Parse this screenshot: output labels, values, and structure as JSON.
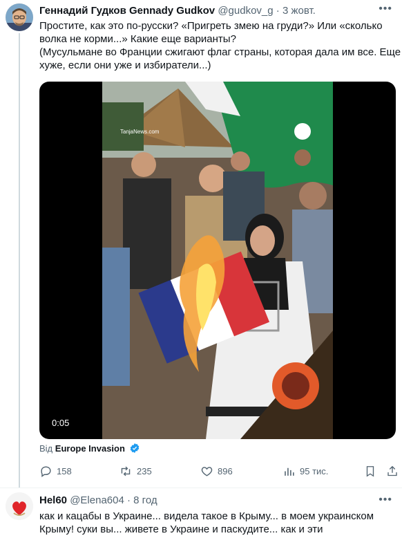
{
  "tweet1": {
    "author_name": "Геннадий Гудков Gennady Gudkov",
    "handle": "@gudkov_g",
    "separator": "·",
    "time": "3 жовт.",
    "more_icon": "more-horizontal-icon",
    "lines": [
      "Простите, как это по-русски? «Пригреть змею на груди?» Или «сколько",
      "волка не корми...» Какие еще варианты?",
      "(Мусульмане во Франции сжигают флаг страны, которая дала им все. Еще",
      "хуже, если они уже и избиратели...)"
    ],
    "video": {
      "duration": "0:05",
      "watermark": "TanjaNews.com"
    },
    "source_prefix": "Від",
    "source_name": "Europe Invasion",
    "actions": {
      "replies": "158",
      "retweets": "235",
      "likes": "896",
      "views": "95 тис."
    }
  },
  "tweet2": {
    "author_name": "Hel60",
    "handle": "@Elena604",
    "separator": "·",
    "time": "8 год",
    "lines": [
      "как и кацабы в Украине... видела такое в Крыму... в моем украинском",
      "Крыму! суки вы... живете в Украине и паскудите... как и эти"
    ]
  },
  "colors": {
    "text": "#0f1419",
    "secondary": "#536471",
    "verified": "#1d9bf0",
    "flag_blue": "#2b3a8c",
    "flag_red": "#d8353a",
    "green_flag": "#1f8a4c"
  }
}
